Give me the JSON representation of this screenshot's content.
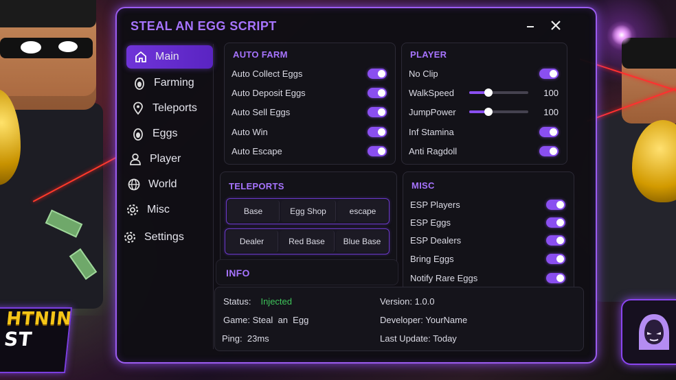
{
  "window": {
    "title": "STEAL AN EGG SCRIPT"
  },
  "promo": {
    "line1": "HTNING",
    "line2": "ST"
  },
  "sidebar": {
    "items": [
      {
        "label": "Main",
        "icon": "home-icon",
        "active": true
      },
      {
        "label": "Farming",
        "icon": "egg-icon",
        "active": false
      },
      {
        "label": "Teleports",
        "icon": "map-pin-icon",
        "active": false
      },
      {
        "label": "Eggs",
        "icon": "egg-icon",
        "active": false
      },
      {
        "label": "Player",
        "icon": "user-icon",
        "active": false
      },
      {
        "label": "World",
        "icon": "globe-icon",
        "active": false
      },
      {
        "label": "Misc",
        "icon": "gear-icon",
        "active": false
      },
      {
        "label": "Settings",
        "icon": "gear-icon",
        "active": false
      }
    ]
  },
  "auto_farm": {
    "title": "AUTO FARM",
    "items": [
      {
        "label": "Auto Collect Eggs",
        "on": true
      },
      {
        "label": "Auto Deposit Eggs",
        "on": true
      },
      {
        "label": "Auto Sell Eggs",
        "on": true
      },
      {
        "label": "Auto Win",
        "on": true
      },
      {
        "label": "Auto Escape",
        "on": true
      }
    ]
  },
  "player": {
    "title": "PLAYER",
    "no_clip": {
      "label": "No Clip",
      "on": true
    },
    "walkspeed": {
      "label": "WalkSpeed",
      "value": "100",
      "level": 0.33
    },
    "jumppower": {
      "label": "JumpPower",
      "value": "100",
      "level": 0.33
    },
    "inf_stamina": {
      "label": "Inf Stamina",
      "on": true
    },
    "anti_ragdoll": {
      "label": "Anti Ragdoll",
      "on": true
    }
  },
  "teleports": {
    "title": "TELEPORTS",
    "row1": [
      "Base",
      "Egg Shop",
      "escape"
    ],
    "row2": [
      "Dealer",
      "Red Base",
      "Blue Base"
    ]
  },
  "misc": {
    "title": "MISC",
    "items": [
      {
        "label": "ESP Players",
        "on": true
      },
      {
        "label": "ESP Eggs",
        "on": true
      },
      {
        "label": "ESP Dealers",
        "on": true
      },
      {
        "label": "Bring Eggs",
        "on": true
      },
      {
        "label": "Notify Rare Eggs",
        "on": true
      }
    ]
  },
  "info": {
    "title": "INFO",
    "status_label": "Status:",
    "status_value": "Injected",
    "game_label": "Game:",
    "game_value": "Steal  an  Egg",
    "ping_label": "Ping:",
    "ping_value": "23ms",
    "version_label": "Version:",
    "version_value": "1.0.0",
    "developer_label": "Developer:",
    "developer_value": "YourName",
    "last_update_label": "Last Update:",
    "last_update_value": "Today"
  },
  "colors": {
    "accent": "#9b5cf0",
    "status_ok": "#3ec45a",
    "title": "#a774ff"
  }
}
